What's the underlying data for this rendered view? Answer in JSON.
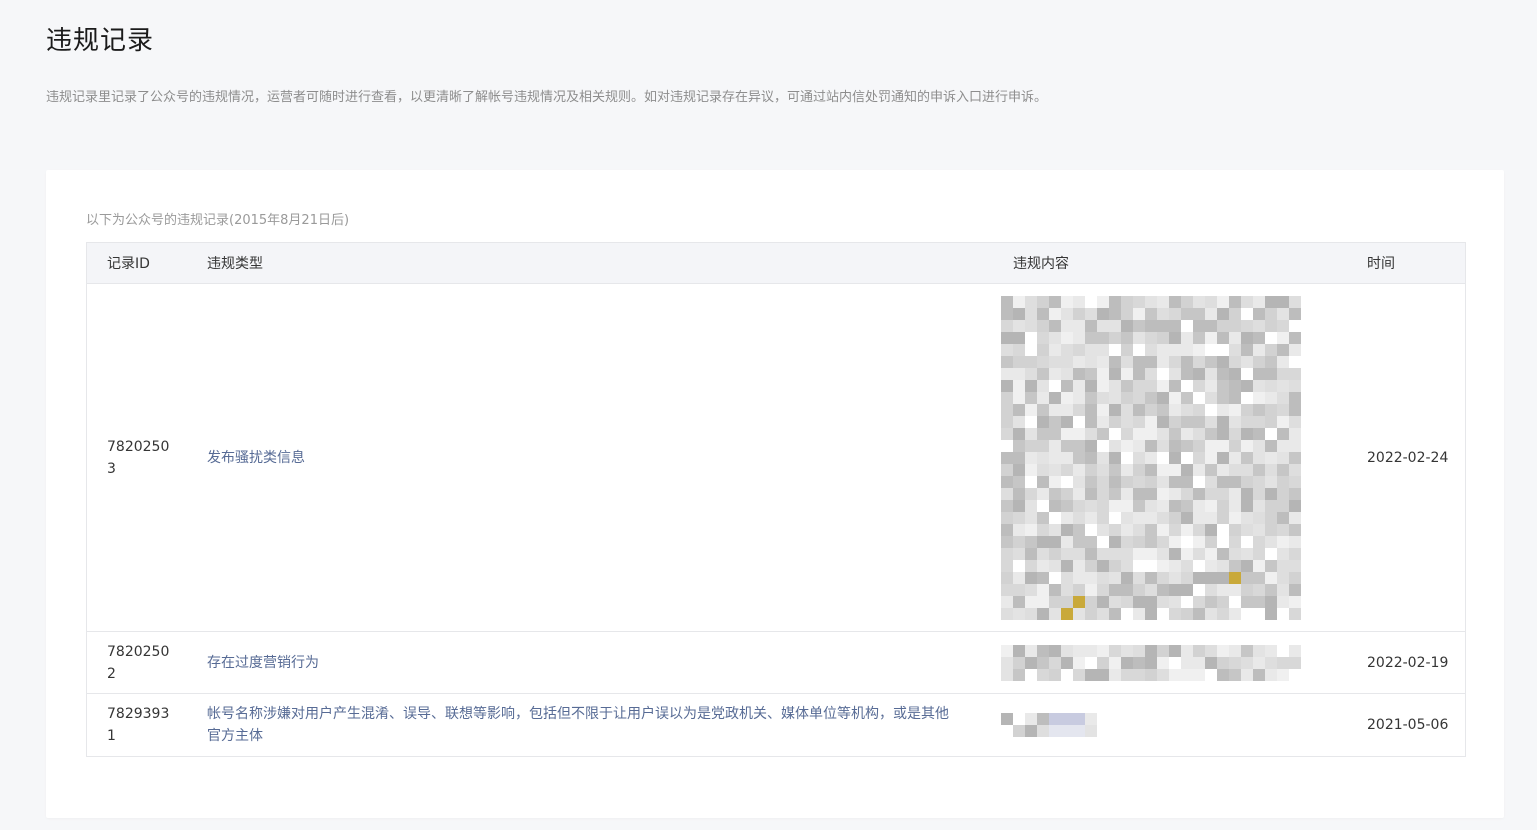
{
  "page": {
    "title": "违规记录",
    "description": "违规记录里记录了公众号的违规情况，运营者可随时进行查看，以更清晰了解帐号违规情况及相关规则。如对违规记录存在异议，可通过站内信处罚通知的申诉入口进行申诉。"
  },
  "card": {
    "note": "以下为公众号的违规记录(2015年8月21日后)"
  },
  "table": {
    "headers": {
      "id": "记录ID",
      "type": "违规类型",
      "content": "违规内容",
      "time": "时间"
    },
    "rows": [
      {
        "id": "78202503",
        "type": "发布骚扰类信息",
        "content": "",
        "time": "2022-02-24"
      },
      {
        "id": "78202502",
        "type": "存在过度营销行为",
        "content": "",
        "time": "2022-02-19"
      },
      {
        "id": "78293931",
        "type": "帐号名称涉嫌对用户产生混淆、误导、联想等影响，包括但不限于让用户误以为是党政机关、媒体单位等机构，或是其他官方主体",
        "content": "",
        "time": "2021-05-06"
      }
    ]
  },
  "colors": {
    "background": "#f6f7f9",
    "card": "#ffffff",
    "link": "#576b95",
    "header_bg": "#f4f5f8",
    "border": "#e6e7ea"
  }
}
